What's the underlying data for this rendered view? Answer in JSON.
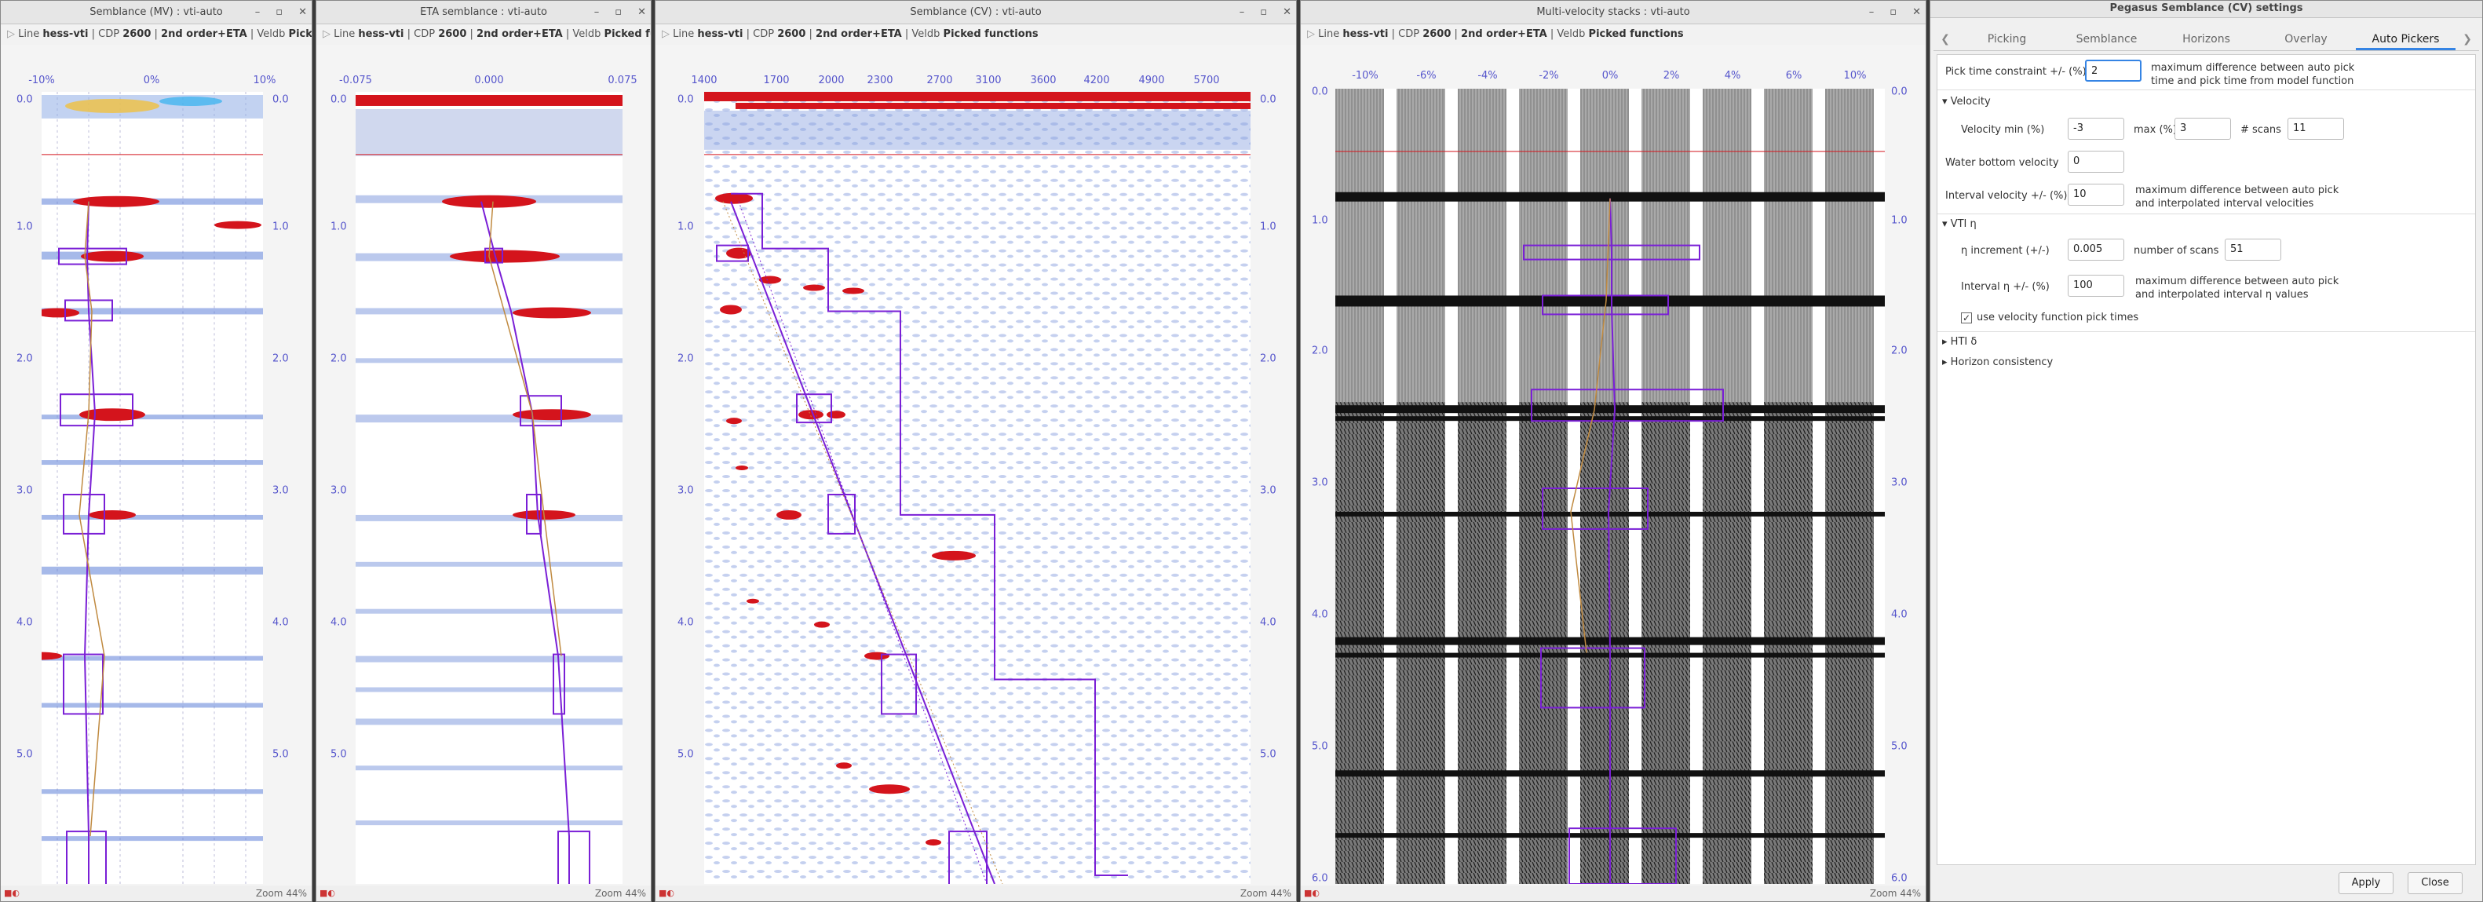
{
  "windows": [
    {
      "title": "Semblance (MV) : vti-auto",
      "info_prefix": "Line",
      "info_line": "hess-vti",
      "info_cdp": "CDP",
      "info_cdp_val": "2600",
      "info_order": "2nd order+ETA",
      "info_veldb": "Veldb",
      "info_picked": "Picked func...",
      "x_ticks": [
        "-10%",
        "0%",
        "10%"
      ],
      "zoom": "Zoom 44%"
    },
    {
      "title": "ETA semblance : vti-auto",
      "info_prefix": "Line",
      "info_line": "hess-vti",
      "info_cdp": "CDP",
      "info_cdp_val": "2600",
      "info_order": "2nd order+ETA",
      "info_veldb": "Veldb",
      "info_picked": "Picked functions",
      "x_ticks": [
        "-0.075",
        "0.000",
        "0.075"
      ],
      "zoom": "Zoom 44%"
    },
    {
      "title": "Semblance (CV) : vti-auto",
      "info_prefix": "Line",
      "info_line": "hess-vti",
      "info_cdp": "CDP",
      "info_cdp_val": "2600",
      "info_order": "2nd order+ETA",
      "info_veldb": "Veldb",
      "info_picked": "Picked functions",
      "x_ticks": [
        "1400",
        "1700",
        "2000",
        "2300",
        "2700",
        "3100",
        "3600",
        "4200",
        "4900",
        "5700"
      ],
      "zoom": "Zoom 44%"
    },
    {
      "title": "Multi-velocity stacks : vti-auto",
      "info_prefix": "Line",
      "info_line": "hess-vti",
      "info_cdp": "CDP",
      "info_cdp_val": "2600",
      "info_order": "2nd order+ETA",
      "info_veldb": "Veldb",
      "info_picked": "Picked functions",
      "x_ticks": [
        "-10%",
        "-6%",
        "-4%",
        "-2%",
        "0%",
        "2%",
        "4%",
        "6%",
        "10%"
      ],
      "zoom": "Zoom 44%"
    }
  ],
  "time_ticks": [
    "0.0",
    "1.0",
    "2.0",
    "3.0",
    "4.0",
    "5.0",
    "6.0"
  ],
  "settings": {
    "title": "Pegasus Semblance (CV) settings",
    "tabs": [
      "Picking",
      "Semblance",
      "Horizons",
      "Overlay",
      "Auto Pickers"
    ],
    "active_tab": "Auto Pickers",
    "pick_time_label": "Pick time constraint +/- (%)",
    "pick_time_value": "2",
    "pick_time_desc": "maximum difference between auto pick time and pick time from model function",
    "velocity_section": "Velocity",
    "vel_min_label": "Velocity min (%)",
    "vel_min_value": "-3",
    "vel_max_label": "max (%)",
    "vel_max_value": "3",
    "vel_scans_label": "# scans",
    "vel_scans_value": "11",
    "water_label": "Water bottom velocity",
    "water_value": "0",
    "interval_vel_label": "Interval velocity +/- (%)",
    "interval_vel_value": "10",
    "interval_vel_desc": "maximum difference between auto pick and interpolated interval velocities",
    "vti_section": "VTI η",
    "eta_inc_label": "η increment (+/-)",
    "eta_inc_value": "0.005",
    "eta_scans_label": "number of scans",
    "eta_scans_value": "51",
    "interval_eta_label": "Interval η +/- (%)",
    "interval_eta_value": "100",
    "interval_eta_desc": "maximum difference between auto pick and interpolated interval η values",
    "use_vel_label": "use velocity function pick times",
    "hti_section": "HTI δ",
    "horizon_section": "Horizon consistency",
    "apply": "Apply",
    "close": "Close"
  },
  "colors": {
    "accent": "#3584e4",
    "pick": "#7a1fd6",
    "axis": "#5555cc",
    "hot": "#d4141c"
  }
}
